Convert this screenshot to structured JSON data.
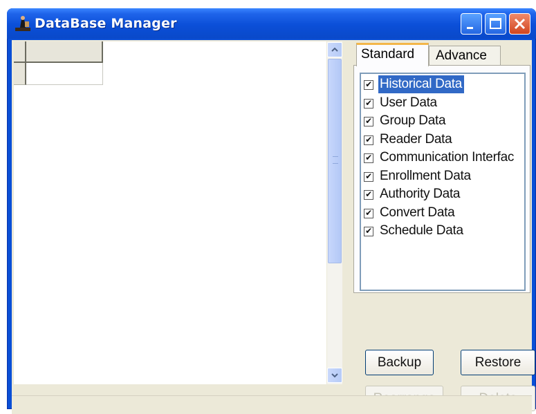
{
  "window": {
    "title": "DataBase Manager"
  },
  "tabs": [
    {
      "label": "Standard",
      "active": true
    },
    {
      "label": "Advance",
      "active": false
    }
  ],
  "data_list": {
    "items": [
      {
        "label": "Historical Data",
        "checked": true,
        "selected": true
      },
      {
        "label": "User Data",
        "checked": true
      },
      {
        "label": "Group Data",
        "checked": true
      },
      {
        "label": "Reader Data",
        "checked": true
      },
      {
        "label": "Communication Interfac",
        "checked": true
      },
      {
        "label": "Enrollment Data",
        "checked": true
      },
      {
        "label": "Authority Data",
        "checked": true
      },
      {
        "label": "Convert Data",
        "checked": true
      },
      {
        "label": "Schedule Data",
        "checked": true
      }
    ]
  },
  "buttons": {
    "backup": "Backup",
    "restore": "Restore",
    "rearrange": "Rearrange",
    "delete": "Delete"
  },
  "colors": {
    "titlebar": "#0a4fd6",
    "selection": "#3169c6",
    "close": "#d1461f"
  },
  "icons": {
    "app": "person-app-icon",
    "minimize": "minimize-icon",
    "maximize": "maximize-icon",
    "close": "close-icon",
    "scroll_up": "chevron-up-icon",
    "scroll_down": "chevron-down-icon"
  }
}
